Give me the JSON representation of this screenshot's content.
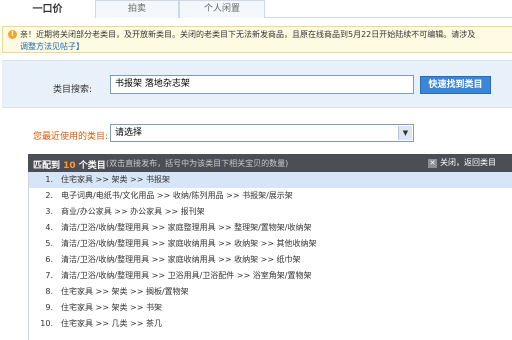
{
  "tabs": [
    {
      "label": "一口价"
    },
    {
      "label": "拍卖"
    },
    {
      "label": "个人闲置"
    }
  ],
  "notice": {
    "icon": "!",
    "line1": "亲！近期将关闭部分老类目，及开放新类目。关闭的老类目下无法新发商品，且原在线商品到5月22日开始陆续不可编辑。请涉及",
    "line2": "调整方法见帖子】"
  },
  "search": {
    "label": "类目搜索:",
    "value": "书报架 落地杂志架",
    "button": "快速找到类目"
  },
  "recent": {
    "label": "您最近使用的类目:",
    "selected": "请选择"
  },
  "results": {
    "prefix": "匹配到 ",
    "count": "10",
    "suffix": " 个类目",
    "hint": "(双击直接发布，括号中为该类目下相关宝贝的数量)",
    "close_label": "关闭，返回类目",
    "items": [
      {
        "num": "1.",
        "text": "住宅家具 >> 架类 >> 书报架"
      },
      {
        "num": "2.",
        "text": "电子词典/电纸书/文化用品 >> 收纳/陈列用品 >> 书报架/展示架"
      },
      {
        "num": "3.",
        "text": "商业/办公家具 >> 办公家具 >> 报刊架"
      },
      {
        "num": "4.",
        "text": "清洁/卫浴/收纳/整理用具 >> 家庭整理用具 >> 整理架/置物架/收纳架"
      },
      {
        "num": "5.",
        "text": "清洁/卫浴/收纳/整理用具 >> 家庭收纳用具 >> 收纳架 >> 其他收纳架"
      },
      {
        "num": "6.",
        "text": "清洁/卫浴/收纳/整理用具 >> 家庭收纳用具 >> 收纳架 >> 纸巾架"
      },
      {
        "num": "7.",
        "text": "清洁/卫浴/收纳/整理用具 >> 卫浴用具/卫浴配件 >> 浴室角架/置物架"
      },
      {
        "num": "8.",
        "text": "住宅家具 >> 架类 >> 搁板/置物架"
      },
      {
        "num": "9.",
        "text": "住宅家具 >> 架类 >> 书架"
      },
      {
        "num": "10.",
        "text": "住宅家具 >> 几类 >> 茶几"
      }
    ]
  },
  "colors": {
    "accent_blue": "#3b86d8",
    "panel_bg": "#e8f0f9",
    "header_dark": "#4b4f55",
    "count_orange": "#ff9a2e",
    "recent_label_orange": "#e05a00"
  }
}
